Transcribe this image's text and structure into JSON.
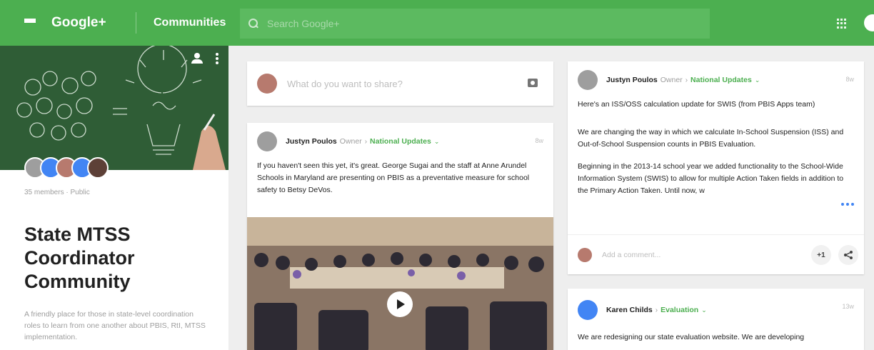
{
  "header": {
    "brand": "Google+",
    "section": "Communities",
    "search_placeholder": "Search Google+"
  },
  "community": {
    "members_meta": "35 members · Public",
    "title": "State MTSS Coordinator Community",
    "description": "A friendly place for those in state-level coordination roles to learn from one another about PBIS, RtI, MTSS implementation."
  },
  "share_box": {
    "prompt": "What do you want to share?"
  },
  "posts": [
    {
      "author": "Justyn Poulos",
      "role": "Owner",
      "category": "National Updates",
      "time": "8w",
      "body": "If you haven't seen this yet, it's great.  George Sugai and the staff at Anne Arundel Schools in Maryland are presenting on PBIS as a preventative measure for school safety to Betsy DeVos."
    },
    {
      "author": "Justyn Poulos",
      "role": "Owner",
      "category": "National Updates",
      "time": "8w",
      "paragraphs": [
        "Here's an ISS/OSS calculation update for SWIS (from PBIS Apps team)",
        "We are changing the way in which we calculate In-School Suspension (ISS) and Out-of-School Suspension counts in PBIS Evaluation.",
        "Beginning in the 2013-14 school year we added functionality to the School-Wide Information System (SWIS) to allow for multiple Action Taken fields in addition to the Primary Action Taken. Until now, w"
      ],
      "comment_prompt": "Add a comment...",
      "plus_one": "+1"
    },
    {
      "author": "Karen Childs",
      "category": "Evaluation",
      "time": "13w",
      "body": "We are redesigning our state evaluation website. We are developing"
    }
  ],
  "colors": {
    "brand_green": "#4caf50",
    "accent_blue": "#4285f4"
  }
}
